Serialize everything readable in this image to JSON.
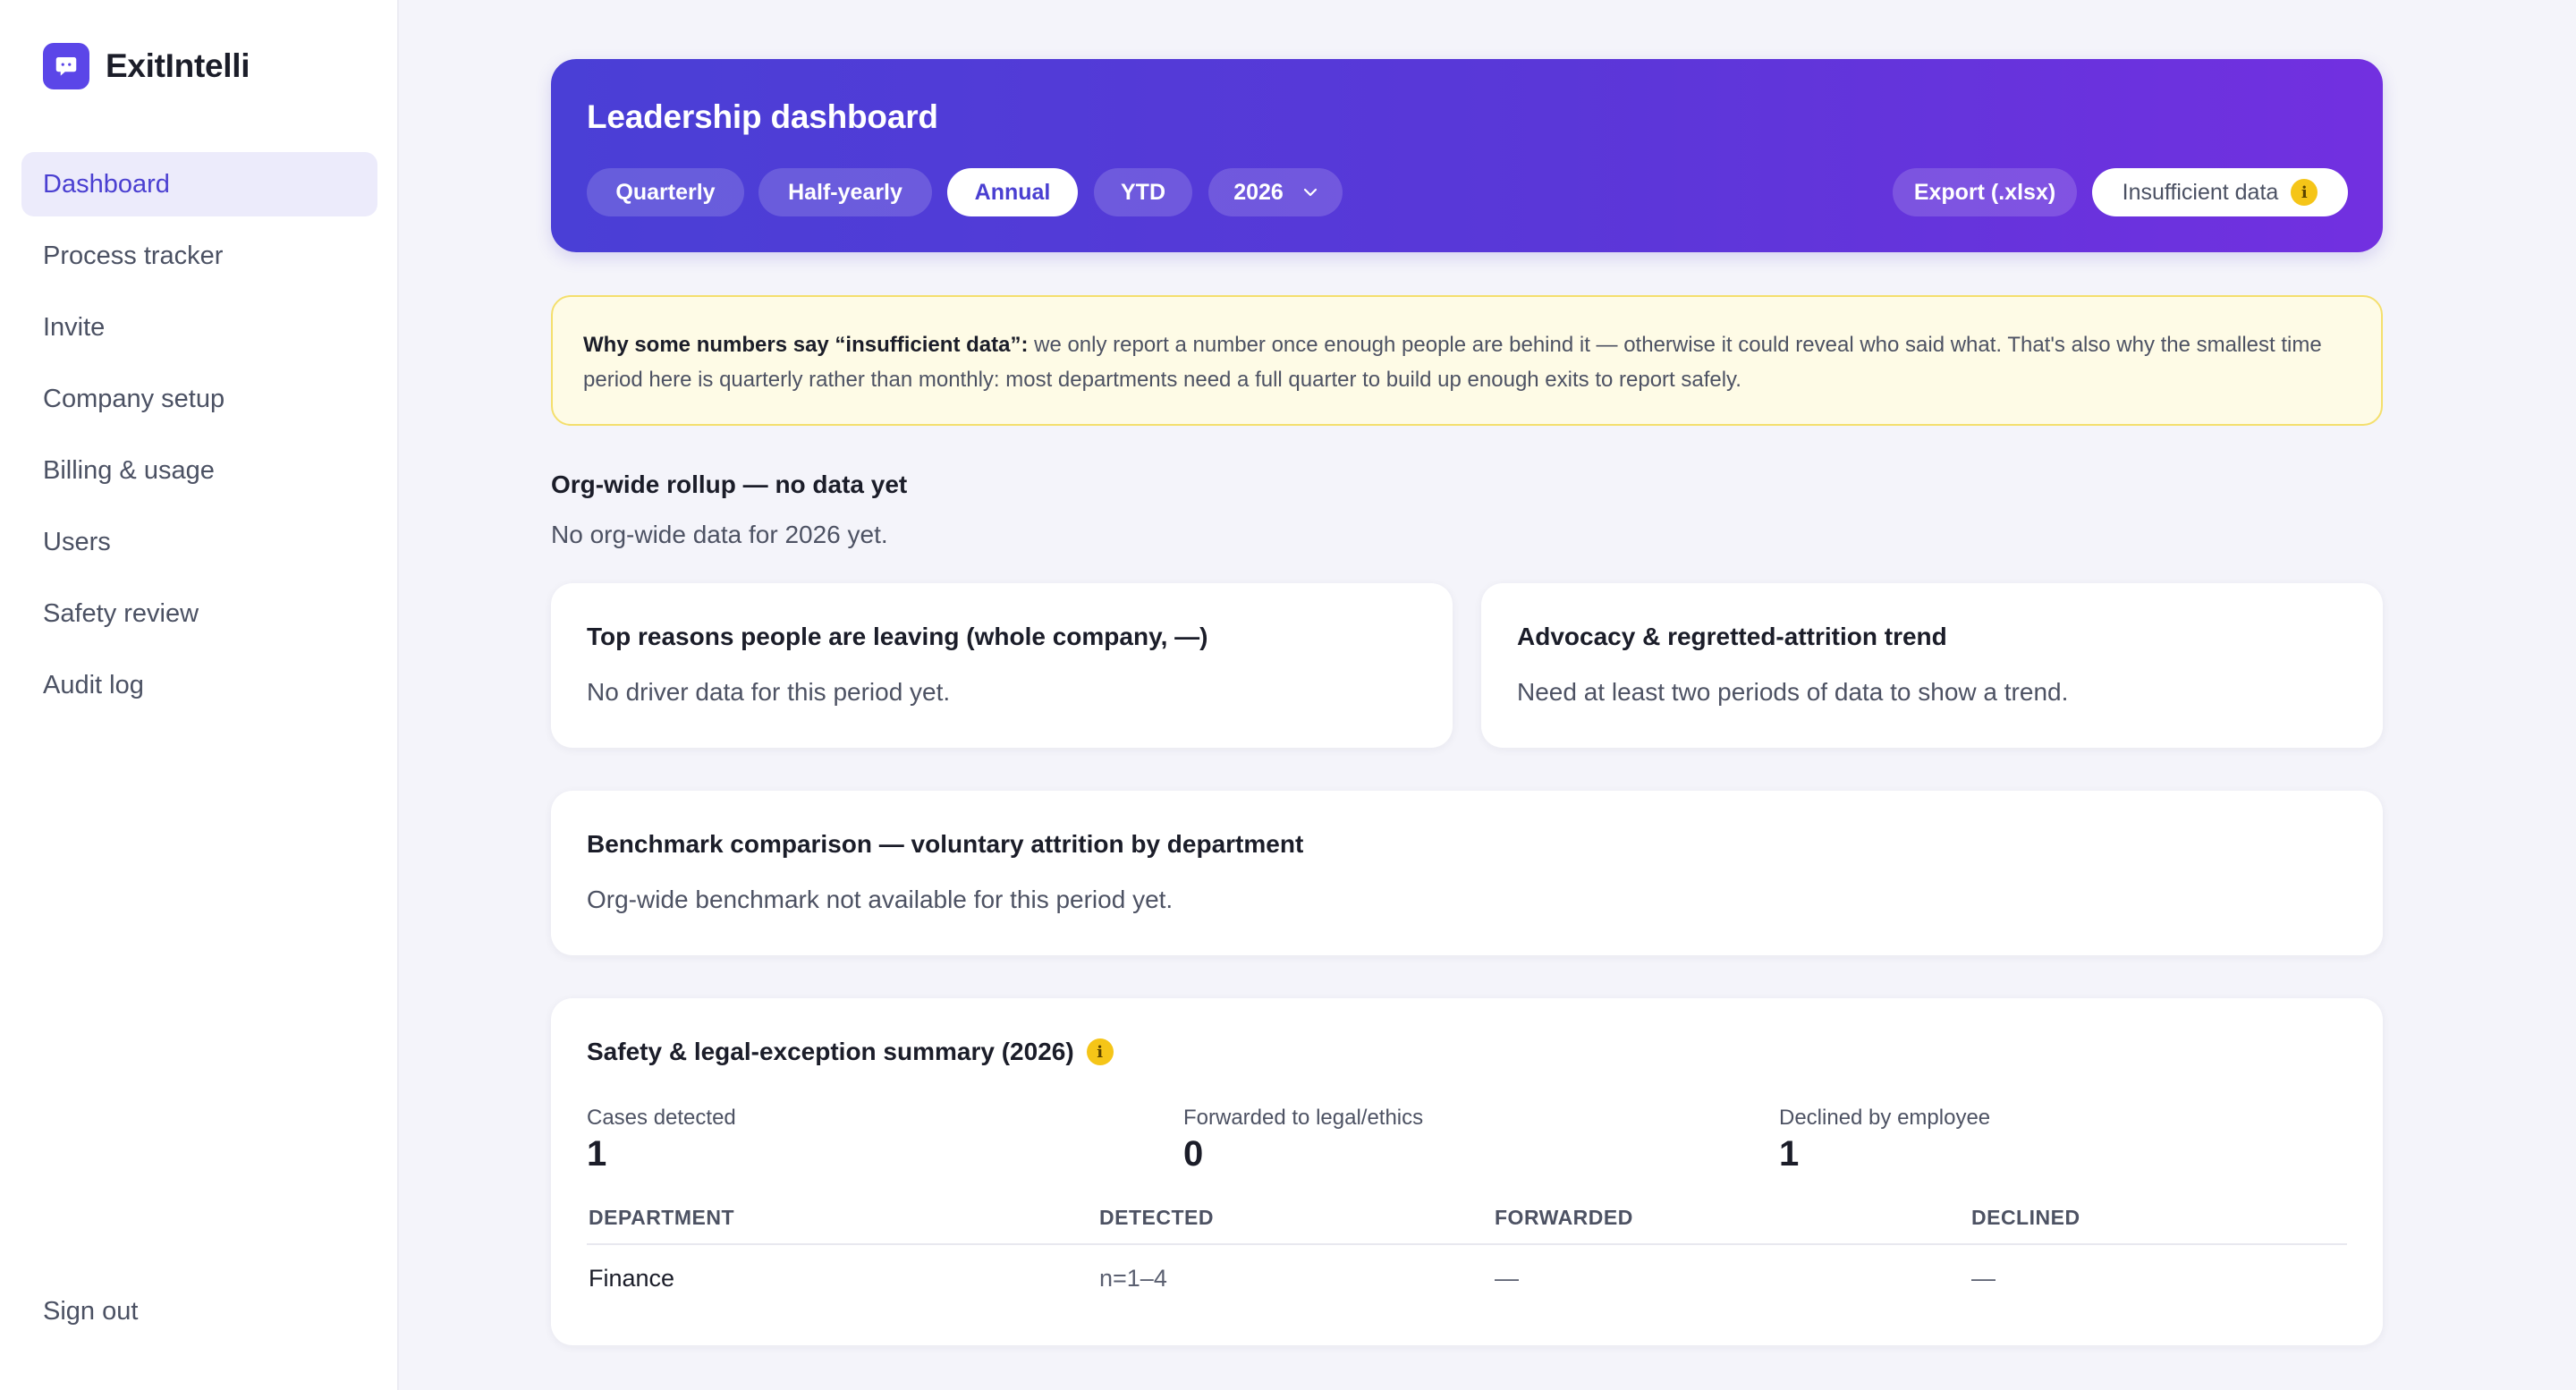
{
  "brand": {
    "name": "ExitIntelli",
    "icon": "chat-bubble-icon",
    "color": "#5b46e8"
  },
  "sidebar": {
    "items": [
      {
        "label": "Dashboard",
        "active": true
      },
      {
        "label": "Process tracker"
      },
      {
        "label": "Invite"
      },
      {
        "label": "Company setup"
      },
      {
        "label": "Billing & usage"
      },
      {
        "label": "Users"
      },
      {
        "label": "Safety review"
      },
      {
        "label": "Audit log"
      }
    ],
    "signout": "Sign out"
  },
  "header": {
    "title": "Leadership dashboard",
    "periods": [
      "Quarterly",
      "Half-yearly",
      "Annual",
      "YTD"
    ],
    "active_period": "Annual",
    "year": "2026",
    "export_label": "Export (.xlsx)",
    "status_label": "Insufficient data",
    "status_icon": "info-icon"
  },
  "notice": {
    "heading": "Why some numbers say “insufficient data”:",
    "body": " we only report a number once enough people are behind it — otherwise it could reveal who said what. That's also why the smallest time period here is quarterly rather than monthly: most departments need a full quarter to build up enough exits to report safely."
  },
  "rollup": {
    "title": "Org-wide rollup — no data yet",
    "subtitle": "No org-wide data for 2026 yet."
  },
  "cards": {
    "reasons": {
      "title": "Top reasons people are leaving (whole company, —)",
      "text": "No driver data for this period yet."
    },
    "advocacy": {
      "title": "Advocacy & regretted-attrition trend",
      "text": "Need at least two periods of data to show a trend."
    },
    "benchmark": {
      "title": "Benchmark comparison — voluntary attrition by department",
      "text": "Org-wide benchmark not available for this period yet."
    }
  },
  "safety": {
    "title": "Safety & legal-exception summary (2026)",
    "stats": [
      {
        "label": "Cases detected",
        "value": "1"
      },
      {
        "label": "Forwarded to legal/ethics",
        "value": "0"
      },
      {
        "label": "Declined by employee",
        "value": "1"
      }
    ],
    "columns": [
      "DEPARTMENT",
      "DETECTED",
      "FORWARDED",
      "DECLINED"
    ],
    "rows": [
      [
        "Finance",
        "n=1–4",
        "—",
        "—"
      ]
    ]
  },
  "colors": {
    "accent": "#4a3fd1",
    "gradient_start": "#4a3fd6",
    "gradient_end": "#7230e0",
    "warning": "#f5c518"
  }
}
